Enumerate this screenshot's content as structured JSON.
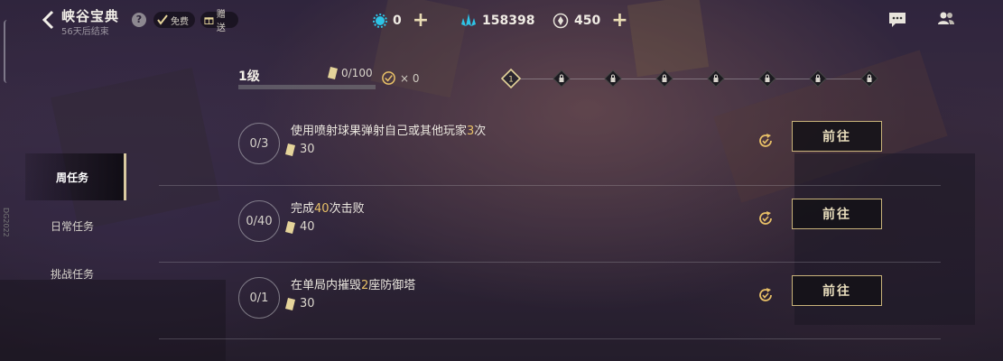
{
  "header": {
    "title": "峡谷宝典",
    "subtitle": "56天后结束",
    "help": "?",
    "badges": [
      {
        "label": "免费",
        "icon": "check-icon"
      },
      {
        "label": "赠送",
        "icon": "gift-icon"
      }
    ]
  },
  "currencies": [
    {
      "icon": "blue-gear-icon",
      "value": "0",
      "has_plus": true
    },
    {
      "icon": "crystal-icon",
      "value": "158398",
      "has_plus": false
    },
    {
      "icon": "coin-icon",
      "value": "450",
      "has_plus": true
    }
  ],
  "plus_label": "+",
  "level": {
    "label": "1级",
    "xp": "0/100",
    "refresh_count": "× 0",
    "progress": 0
  },
  "level_track": {
    "current_node": "1",
    "nodes": [
      "1",
      "lock",
      "lock",
      "lock",
      "lock",
      "lock",
      "lock",
      "lock"
    ]
  },
  "tabs": [
    {
      "label": "周任务",
      "active": true
    },
    {
      "label": "日常任务",
      "active": false
    },
    {
      "label": "挑战任务",
      "active": false
    }
  ],
  "side_text": "DG2022",
  "quests": [
    {
      "progress": "0/3",
      "desc_pre": "使用喷射球果弹射自己或其他玩家",
      "desc_hl": "3",
      "desc_post": "次",
      "reward": "30",
      "button": "前往"
    },
    {
      "progress": "0/40",
      "desc_pre": "完成",
      "desc_hl": "40",
      "desc_post": "次击败",
      "reward": "40",
      "button": "前往"
    },
    {
      "progress": "0/1",
      "desc_pre": "在单局内摧毁",
      "desc_hl": "2",
      "desc_post": "座防御塔",
      "reward": "30",
      "button": "前往"
    }
  ],
  "colors": {
    "accent_gold": "#e8c067",
    "button_border": "#c9b37a",
    "currency_blue": "#2ec4e6"
  }
}
